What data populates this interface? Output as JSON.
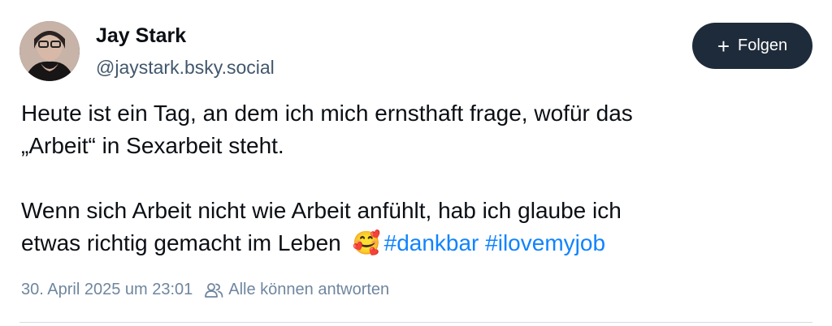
{
  "author": {
    "name": "Jay Stark",
    "handle": "@jaystark.bsky.social",
    "avatar_icon": "avatar-photo"
  },
  "follow_button": {
    "icon": "plus-icon",
    "label": "Folgen"
  },
  "post": {
    "lines": [
      "Heute ist ein Tag, an dem ich mich ernsthaft frage, wofür das",
      "„Arbeit“ in Sexarbeit steht.",
      "",
      "Wenn sich Arbeit nicht wie Arbeit anfühlt, hab ich glaube ich",
      "etwas richtig gemacht im Leben"
    ],
    "emoji": "🥰",
    "hashtags": [
      "#dankbar",
      "#ilovemyjob"
    ]
  },
  "meta": {
    "timestamp": "30. April 2025 um 23:01",
    "reply_icon": "people-icon",
    "reply_setting": "Alle können antworten"
  },
  "colors": {
    "link": "#1083fe",
    "button_bg": "#1e2b3a",
    "muted": "#6f869f"
  }
}
